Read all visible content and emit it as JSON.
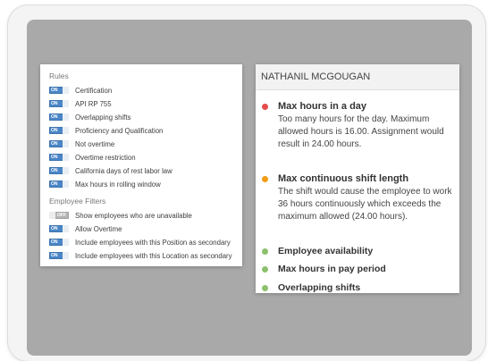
{
  "rules_panel": {
    "rules_title": "Rules",
    "rules": [
      {
        "state": "ON",
        "label": "Certification"
      },
      {
        "state": "ON",
        "label": "API RP 755"
      },
      {
        "state": "ON",
        "label": "Overlapping shifts"
      },
      {
        "state": "ON",
        "label": "Proficiency and Qualification"
      },
      {
        "state": "ON",
        "label": "Not overtime"
      },
      {
        "state": "ON",
        "label": "Overtime restriction"
      },
      {
        "state": "ON",
        "label": "California days of rest labor law"
      },
      {
        "state": "ON",
        "label": "Max hours in rolling window"
      }
    ],
    "filters_title": "Employee Filters",
    "filters": [
      {
        "state": "OFF",
        "label": "Show employees who are unavailable"
      },
      {
        "state": "ON",
        "label": "Allow Overtime"
      },
      {
        "state": "ON",
        "label": "Include employees with this Position as secondary"
      },
      {
        "state": "ON",
        "label": "Include employees with this Location as secondary"
      }
    ]
  },
  "employee_panel": {
    "employee_name": "NATHANIL MCGOUGAN",
    "warnings": [
      {
        "status_color": "#e74c4c",
        "title": "Max hours in a day",
        "body": "Too many hours for the day. Maximum allowed hours is 16.00. Assignment would result in 24.00 hours."
      },
      {
        "status_color": "#f39c12",
        "title": "Max continuous shift length",
        "body": "The shift would cause the employee to work 36 hours continuously which exceeds the maximum allowed (24.00 hours)."
      }
    ],
    "checks": [
      {
        "status_color": "#8cc06b",
        "title": "Employee availability"
      },
      {
        "status_color": "#8cc06b",
        "title": "Max hours in pay period"
      },
      {
        "status_color": "#8cc06b",
        "title": "Overlapping shifts"
      }
    ]
  }
}
